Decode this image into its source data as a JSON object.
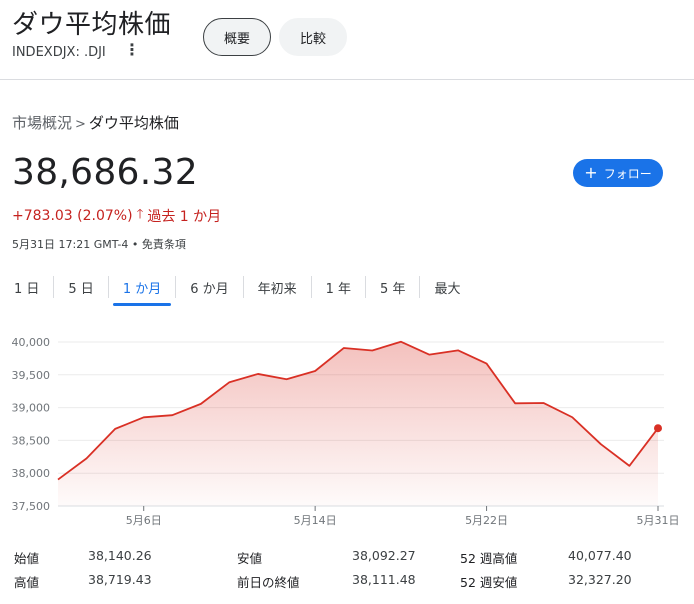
{
  "header": {
    "title": "ダウ平均株価",
    "ticker": "INDEXDJX: .DJI",
    "more_icon": "⋮",
    "tabs": [
      {
        "label": "概要",
        "active": true
      },
      {
        "label": "比較",
        "active": false
      }
    ]
  },
  "breadcrumb": {
    "parent": "市場概況",
    "separator": ">",
    "current": "ダウ平均株価"
  },
  "quote": {
    "price": "38,686.32",
    "change": "+783.03 (2.07%)",
    "change_arrow": "🡑",
    "period": "過去 1 か月",
    "timestamp": "5月31日 17:21 GMT-4 • 免責条項",
    "change_color": "#c5221f"
  },
  "follow_button": {
    "label": "フォロー",
    "plus": "+",
    "color": "#1a73e8"
  },
  "range_tabs": [
    {
      "label": "1 日",
      "active": false
    },
    {
      "label": "5 日",
      "active": false
    },
    {
      "label": "1 か月",
      "active": true
    },
    {
      "label": "6 か月",
      "active": false
    },
    {
      "label": "年初来",
      "active": false
    },
    {
      "label": "1 年",
      "active": false
    },
    {
      "label": "5 年",
      "active": false
    },
    {
      "label": "最大",
      "active": false
    }
  ],
  "chart_data": {
    "type": "area",
    "y_ticks": [
      "40,000",
      "39,500",
      "39,000",
      "38,500",
      "38,000",
      "37,500"
    ],
    "y_tick_values": [
      40000,
      39500,
      39000,
      38500,
      38000,
      37500
    ],
    "ylim": [
      37500,
      40000
    ],
    "x_ticks": [
      "5月6日",
      "5月14日",
      "5月22日",
      "5月31日"
    ],
    "x_tick_index": [
      4,
      10,
      16,
      22
    ],
    "x": [
      "5月1日",
      "5月2日",
      "5月3日",
      "5月6日",
      "5月7日",
      "5月8日",
      "5月9日",
      "5月10日",
      "5月13日",
      "5月14日",
      "5月15日",
      "5月16日",
      "5月17日",
      "5月20日",
      "5月21日",
      "5月22日",
      "5月23日",
      "5月24日",
      "5月28日",
      "5月29日",
      "5月30日",
      "5月31日"
    ],
    "values": [
      37903,
      38226,
      38676,
      38852,
      38884,
      39057,
      39387,
      39513,
      39432,
      39558,
      39908,
      39870,
      40004,
      39807,
      39873,
      39671,
      39065,
      39070,
      38853,
      38442,
      38112,
      38686
    ],
    "line_color": "#d93025",
    "grid": true
  },
  "stats": {
    "rows": [
      [
        {
          "label": "始値",
          "value": "38,140.26"
        },
        {
          "label": "安値",
          "value": "38,092.27"
        },
        {
          "label": "52 週高値",
          "value": "40,077.40"
        }
      ],
      [
        {
          "label": "高値",
          "value": "38,719.43"
        },
        {
          "label": "前日の終値",
          "value": "38,111.48"
        },
        {
          "label": "52 週安値",
          "value": "32,327.20"
        }
      ]
    ]
  }
}
